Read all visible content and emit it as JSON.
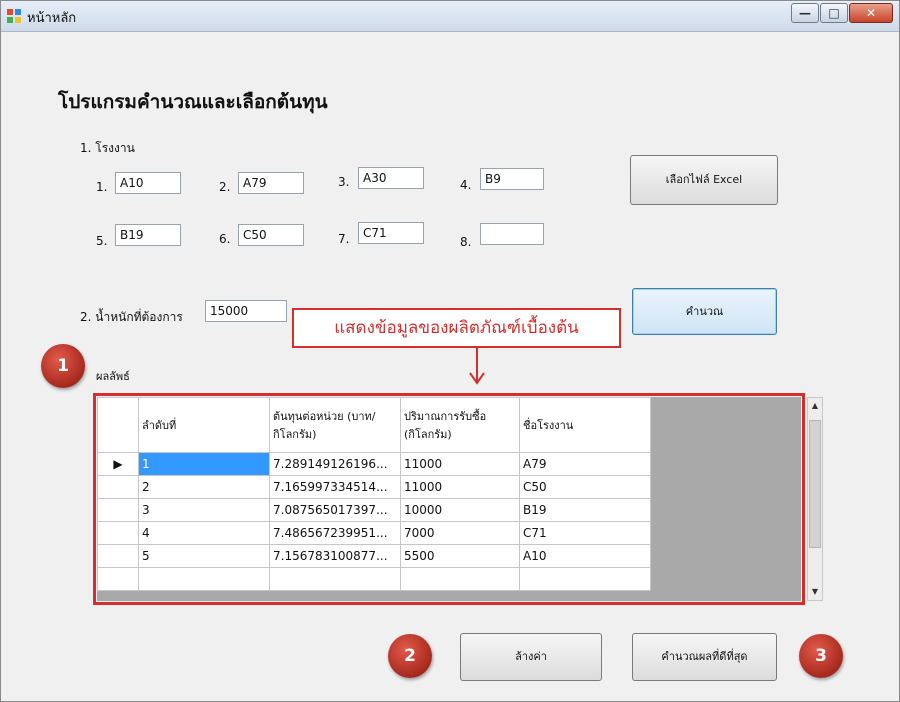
{
  "window": {
    "title": "หน้าหลัก",
    "min_glyph": "—",
    "max_glyph": "□",
    "close_glyph": "✕"
  },
  "heading": "โปรแกรมคำนวณและเลือกต้นทุน",
  "section1": {
    "label": "1. โรงงาน",
    "fields": [
      {
        "num": "1.",
        "value": "A10"
      },
      {
        "num": "2.",
        "value": "A79"
      },
      {
        "num": "3.",
        "value": "A30"
      },
      {
        "num": "4.",
        "value": "B9"
      },
      {
        "num": "5.",
        "value": "B19"
      },
      {
        "num": "6.",
        "value": "C50"
      },
      {
        "num": "7.",
        "value": "C71"
      },
      {
        "num": "8.",
        "value": ""
      }
    ]
  },
  "select_excel_label": "เลือกไฟล์ Excel",
  "section2": {
    "label": "2. น้ำหนักที่ต้องการ",
    "value": "15000"
  },
  "calculate_label": "คำนวณ",
  "callout_text": "แสดงข้อมูลของผลิตภัณฑ์เบื้องต้น",
  "result_label": "ผลลัพธ์",
  "grid": {
    "columns": [
      "ลำดับที่",
      "ต้นทุนต่อหน่วย (บาท/กิโลกรัม)",
      "ปริมาณการรับซื้อ (กิโลกรัม)",
      "ชื่อโรงงาน"
    ],
    "rows": [
      [
        "1",
        "7.289149126196...",
        "11000",
        "A79"
      ],
      [
        "2",
        "7.165997334514...",
        "11000",
        "C50"
      ],
      [
        "3",
        "7.087565017397...",
        "10000",
        "B19"
      ],
      [
        "4",
        "7.486567239951...",
        "7000",
        "C71"
      ],
      [
        "5",
        "7.156783100877...",
        "5500",
        "A10"
      ]
    ],
    "selected_row_marker": "▶",
    "scroll_up_glyph": "▲",
    "scroll_down_glyph": "▼"
  },
  "clear_label": "ล้างค่า",
  "best_label": "คำนวณผลที่ดีที่สุด",
  "badges": [
    "1",
    "2",
    "3"
  ],
  "colors": {
    "annotation_red": "#d32f2f",
    "selection_blue": "#3399ff",
    "grid_background": "#a9a9a9"
  }
}
